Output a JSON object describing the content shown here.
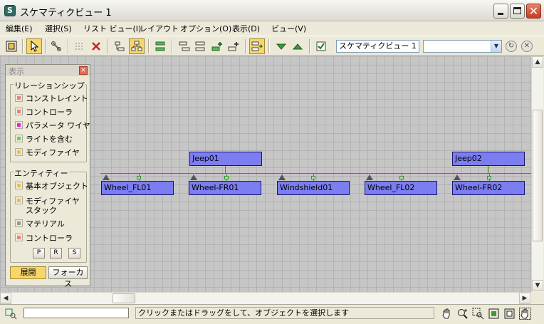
{
  "window": {
    "title": "スケマティクビュー 1"
  },
  "menu": [
    "編集(E)",
    "選択(S)",
    "リスト ビュー(I)",
    "レイアウト",
    "オプション(O)",
    "表示(D)",
    "ビュー(V)"
  ],
  "toolbar": {
    "view_name": "スケマティクビュー 1",
    "combo_value": ""
  },
  "panel": {
    "title": "表示",
    "close_label": "×",
    "relationship_group": "リレーションシップ",
    "relationships": [
      {
        "label": "コンストレイント",
        "color": "#f08080"
      },
      {
        "label": "コントローラ",
        "color": "#f08080"
      },
      {
        "label": "パラメータ ワイヤ",
        "color": "#e020e0"
      },
      {
        "label": "ライトを含む",
        "color": "#50e050"
      },
      {
        "label": "モディファイヤ",
        "color": "#f0c040"
      }
    ],
    "entity_group": "エンティティー",
    "entities": [
      {
        "label": "基本オブジェクト",
        "color": "#f0c040"
      },
      {
        "label": "モディファイヤ",
        "label2": "スタック",
        "color": "#f0c040"
      },
      {
        "label": "マテリアル",
        "color": "#a09880"
      },
      {
        "label": "コントローラ",
        "color": "#f08080"
      }
    ],
    "filter_buttons": [
      "P",
      "R",
      "S"
    ],
    "expand_label": "展開",
    "focus_label": "フォーカス"
  },
  "nodes": {
    "jeep01": "Jeep01",
    "jeep02": "Jeep02",
    "children": [
      "Wheel_FL01",
      "Wheel-FR01",
      "Windshield01",
      "Wheel_FL02",
      "Wheel-FR02"
    ]
  },
  "colors": {
    "node_fill": "#7b7df0",
    "wire": "#2a9a2a",
    "active_button": "#f7d66b"
  },
  "status": {
    "input_value": "",
    "message": "クリックまたはドラッグをして、オブジェクトを選択します"
  }
}
